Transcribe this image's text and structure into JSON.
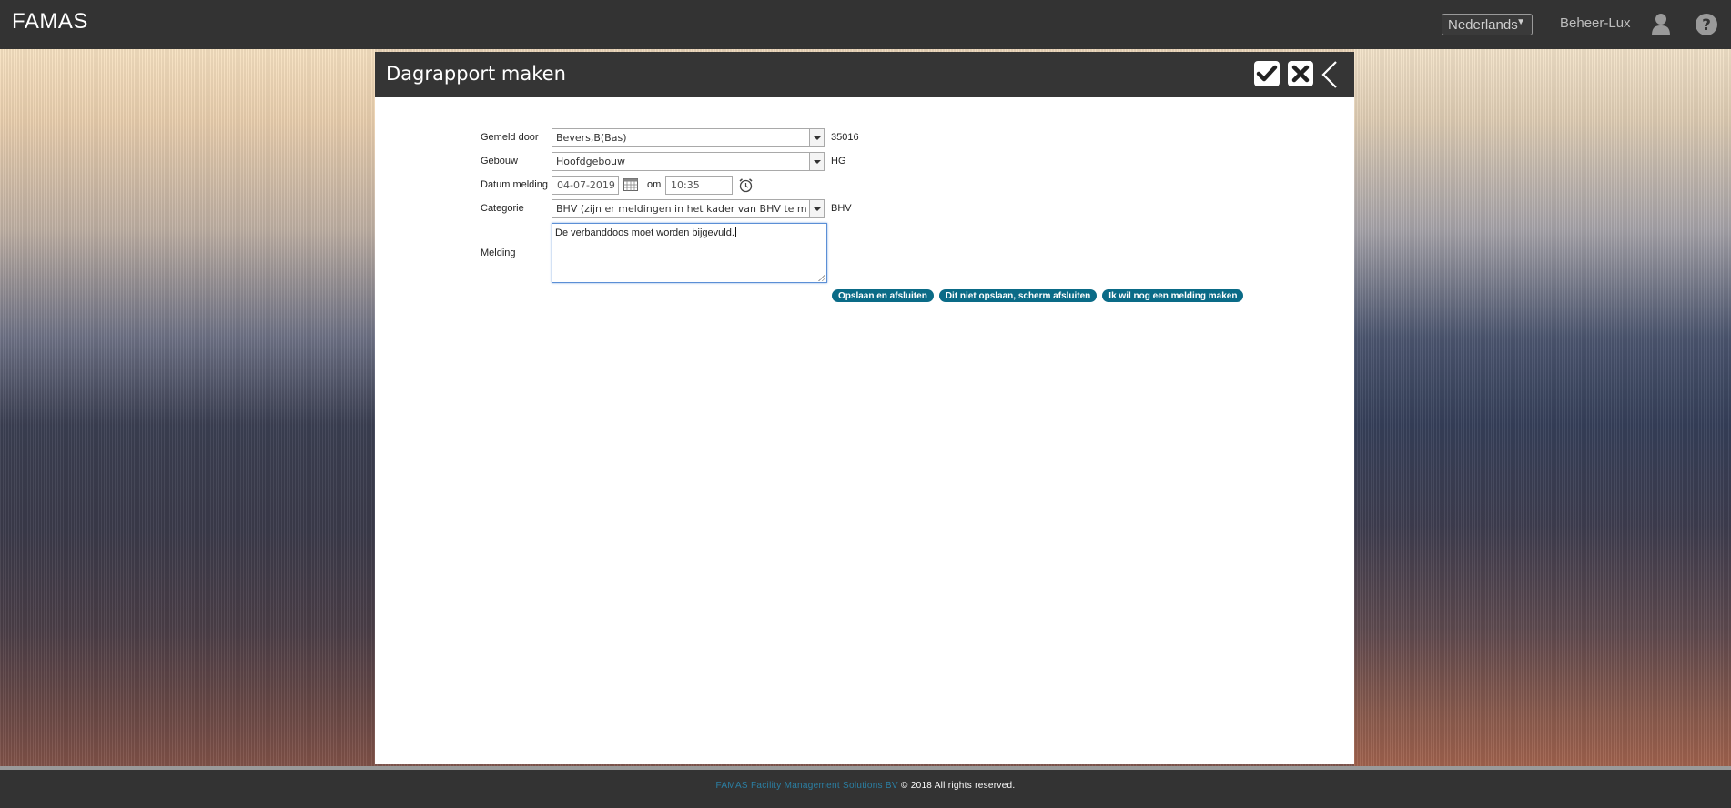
{
  "app": {
    "brand": "FAMAS"
  },
  "topbar": {
    "language": "Nederlands",
    "user_name": "Beheer-Lux"
  },
  "panel": {
    "title": "Dagrapport maken"
  },
  "form": {
    "gemeld_door": {
      "label": "Gemeld door",
      "value": "Bevers,B(Bas)",
      "code": "35016"
    },
    "gebouw": {
      "label": "Gebouw",
      "value": "Hoofdgebouw",
      "code": "HG"
    },
    "datum_melding": {
      "label": "Datum melding",
      "date": "04-07-2019",
      "om_label": "om",
      "time": "10:35"
    },
    "categorie": {
      "label": "Categorie",
      "value": "BHV (zijn er meldingen in het kader van BHV te maken)",
      "code": "BHV"
    },
    "melding": {
      "label": "Melding",
      "value": "De verbanddoos moet worden bijgevuld."
    }
  },
  "actions": {
    "save_close": "Opslaan en afsluiten",
    "discard_close": "Dit niet opslaan, scherm afsluiten",
    "new_report": "Ik wil nog een melding maken"
  },
  "footer": {
    "company": "FAMAS Facility Management Solutions BV",
    "rights": "© 2018 All rights reserved."
  },
  "colors": {
    "topbar": "#333333",
    "accent_button": "#0a6b87",
    "footer_link": "#2b7fa3"
  }
}
